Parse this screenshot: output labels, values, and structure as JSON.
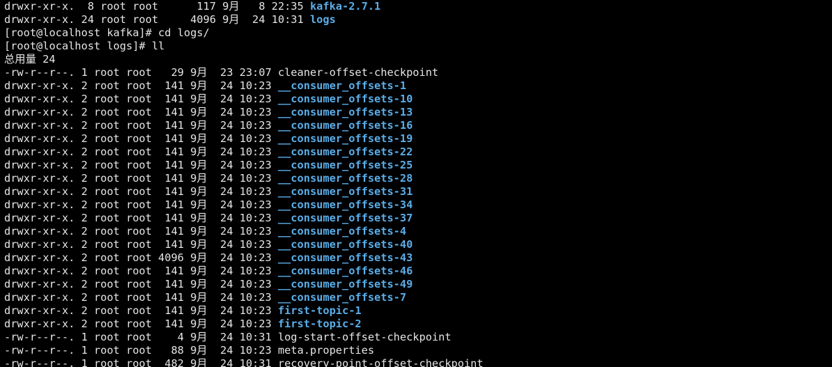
{
  "terminal": {
    "colors": {
      "background": "#000000",
      "foreground": "#e6e6e6",
      "directory": "#5aaeea"
    },
    "lines": [
      {
        "segments": [
          {
            "text": "drwxr-xr-x.  8 root root      117 9月   8 22:35 ",
            "kind": "plain"
          },
          {
            "text": "kafka-2.7.1",
            "kind": "dir"
          }
        ]
      },
      {
        "segments": [
          {
            "text": "drwxr-xr-x. 24 root root     4096 9月  24 10:31 ",
            "kind": "plain"
          },
          {
            "text": "logs",
            "kind": "dir"
          }
        ]
      },
      {
        "segments": [
          {
            "text": "[root@localhost kafka]# cd logs/",
            "kind": "plain"
          }
        ]
      },
      {
        "segments": [
          {
            "text": "[root@localhost logs]# ll",
            "kind": "plain"
          }
        ]
      },
      {
        "segments": [
          {
            "text": "总用量 24",
            "kind": "plain"
          }
        ]
      },
      {
        "segments": [
          {
            "text": "-rw-r--r--. 1 root root   29 9月  23 23:07 cleaner-offset-checkpoint",
            "kind": "plain"
          }
        ]
      },
      {
        "segments": [
          {
            "text": "drwxr-xr-x. 2 root root  141 9月  24 10:23 ",
            "kind": "plain"
          },
          {
            "text": "__consumer_offsets-1",
            "kind": "dir"
          }
        ]
      },
      {
        "segments": [
          {
            "text": "drwxr-xr-x. 2 root root  141 9月  24 10:23 ",
            "kind": "plain"
          },
          {
            "text": "__consumer_offsets-10",
            "kind": "dir"
          }
        ]
      },
      {
        "segments": [
          {
            "text": "drwxr-xr-x. 2 root root  141 9月  24 10:23 ",
            "kind": "plain"
          },
          {
            "text": "__consumer_offsets-13",
            "kind": "dir"
          }
        ]
      },
      {
        "segments": [
          {
            "text": "drwxr-xr-x. 2 root root  141 9月  24 10:23 ",
            "kind": "plain"
          },
          {
            "text": "__consumer_offsets-16",
            "kind": "dir"
          }
        ]
      },
      {
        "segments": [
          {
            "text": "drwxr-xr-x. 2 root root  141 9月  24 10:23 ",
            "kind": "plain"
          },
          {
            "text": "__consumer_offsets-19",
            "kind": "dir"
          }
        ]
      },
      {
        "segments": [
          {
            "text": "drwxr-xr-x. 2 root root  141 9月  24 10:23 ",
            "kind": "plain"
          },
          {
            "text": "__consumer_offsets-22",
            "kind": "dir"
          }
        ]
      },
      {
        "segments": [
          {
            "text": "drwxr-xr-x. 2 root root  141 9月  24 10:23 ",
            "kind": "plain"
          },
          {
            "text": "__consumer_offsets-25",
            "kind": "dir"
          }
        ]
      },
      {
        "segments": [
          {
            "text": "drwxr-xr-x. 2 root root  141 9月  24 10:23 ",
            "kind": "plain"
          },
          {
            "text": "__consumer_offsets-28",
            "kind": "dir"
          }
        ]
      },
      {
        "segments": [
          {
            "text": "drwxr-xr-x. 2 root root  141 9月  24 10:23 ",
            "kind": "plain"
          },
          {
            "text": "__consumer_offsets-31",
            "kind": "dir"
          }
        ]
      },
      {
        "segments": [
          {
            "text": "drwxr-xr-x. 2 root root  141 9月  24 10:23 ",
            "kind": "plain"
          },
          {
            "text": "__consumer_offsets-34",
            "kind": "dir"
          }
        ]
      },
      {
        "segments": [
          {
            "text": "drwxr-xr-x. 2 root root  141 9月  24 10:23 ",
            "kind": "plain"
          },
          {
            "text": "__consumer_offsets-37",
            "kind": "dir"
          }
        ]
      },
      {
        "segments": [
          {
            "text": "drwxr-xr-x. 2 root root  141 9月  24 10:23 ",
            "kind": "plain"
          },
          {
            "text": "__consumer_offsets-4",
            "kind": "dir"
          }
        ]
      },
      {
        "segments": [
          {
            "text": "drwxr-xr-x. 2 root root  141 9月  24 10:23 ",
            "kind": "plain"
          },
          {
            "text": "__consumer_offsets-40",
            "kind": "dir"
          }
        ]
      },
      {
        "segments": [
          {
            "text": "drwxr-xr-x. 2 root root 4096 9月  24 10:23 ",
            "kind": "plain"
          },
          {
            "text": "__consumer_offsets-43",
            "kind": "dir"
          }
        ]
      },
      {
        "segments": [
          {
            "text": "drwxr-xr-x. 2 root root  141 9月  24 10:23 ",
            "kind": "plain"
          },
          {
            "text": "__consumer_offsets-46",
            "kind": "dir"
          }
        ]
      },
      {
        "segments": [
          {
            "text": "drwxr-xr-x. 2 root root  141 9月  24 10:23 ",
            "kind": "plain"
          },
          {
            "text": "__consumer_offsets-49",
            "kind": "dir"
          }
        ]
      },
      {
        "segments": [
          {
            "text": "drwxr-xr-x. 2 root root  141 9月  24 10:23 ",
            "kind": "plain"
          },
          {
            "text": "__consumer_offsets-7",
            "kind": "dir"
          }
        ]
      },
      {
        "segments": [
          {
            "text": "drwxr-xr-x. 2 root root  141 9月  24 10:23 ",
            "kind": "plain"
          },
          {
            "text": "first-topic-1",
            "kind": "dir"
          }
        ]
      },
      {
        "segments": [
          {
            "text": "drwxr-xr-x. 2 root root  141 9月  24 10:23 ",
            "kind": "plain"
          },
          {
            "text": "first-topic-2",
            "kind": "dir"
          }
        ]
      },
      {
        "segments": [
          {
            "text": "-rw-r--r--. 1 root root    4 9月  24 10:31 log-start-offset-checkpoint",
            "kind": "plain"
          }
        ]
      },
      {
        "segments": [
          {
            "text": "-rw-r--r--. 1 root root   88 9月  24 10:23 meta.properties",
            "kind": "plain"
          }
        ]
      },
      {
        "segments": [
          {
            "text": "-rw-r--r--. 1 root root  482 9月  24 10:31 recovery-point-offset-checkpoint",
            "kind": "plain"
          }
        ]
      }
    ]
  }
}
